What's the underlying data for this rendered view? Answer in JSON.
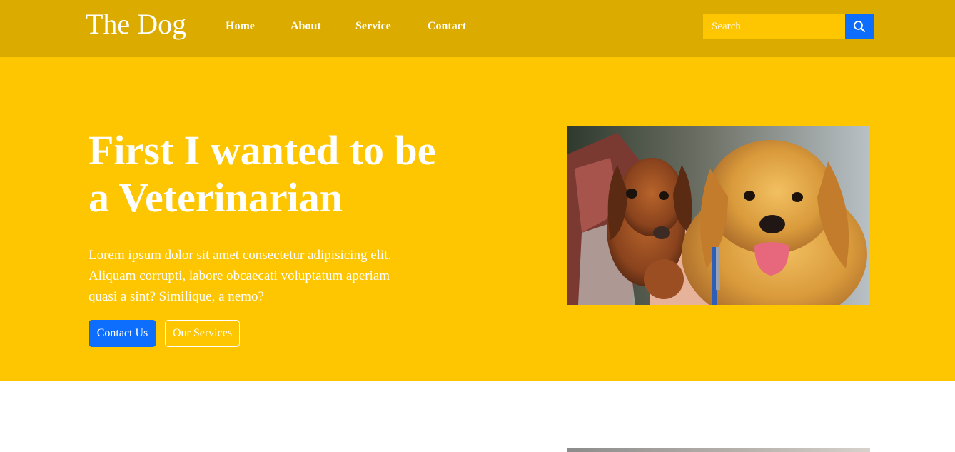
{
  "header": {
    "brand": "The Dog",
    "nav": [
      "Home",
      "About",
      "Service",
      "Contact"
    ],
    "search": {
      "placeholder": "Search"
    }
  },
  "hero": {
    "title": "First I wanted to be a Veterinarian",
    "text": "Lorem ipsum dolor sit amet consectetur adipisicing elit. Aliquam corrupti, labore obcaecati voluptatum aperiam quasi a sint? Similique, a nemo?",
    "primary_button": "Contact Us",
    "secondary_button": "Our Services"
  },
  "colors": {
    "navbar": "#dbab00",
    "hero_background": "#fec601",
    "accent_blue": "#0d6efd",
    "text": "#ffffff"
  },
  "icons": {
    "search_button": "search-icon"
  }
}
